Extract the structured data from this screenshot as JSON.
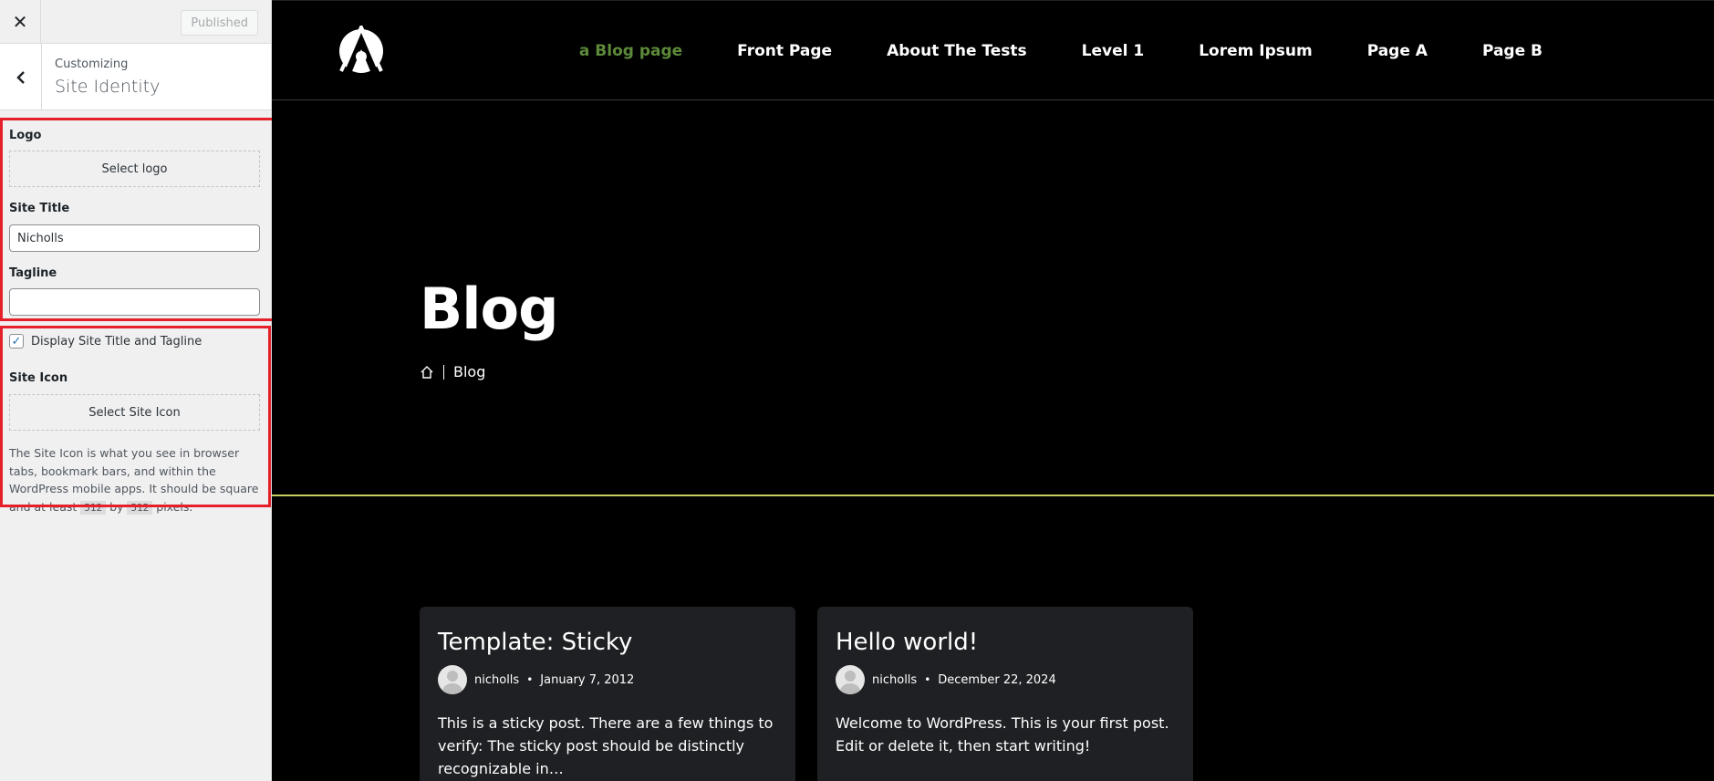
{
  "customizer": {
    "close_icon": "close-icon",
    "publish_label": "Published",
    "back_icon": "chevron-left-icon",
    "crumb": "Customizing",
    "section_title": "Site Identity",
    "logo_label": "Logo",
    "logo_button": "Select logo",
    "site_title_label": "Site Title",
    "site_title_value": "Nicholls",
    "tagline_label": "Tagline",
    "tagline_value": "",
    "display_label": "Display Site Title and Tagline",
    "display_checked": true,
    "site_icon_label": "Site Icon",
    "site_icon_button": "Select Site Icon",
    "site_icon_desc_pre": "The Site Icon is what you see in browser tabs, bookmark bars, and within the WordPress mobile apps. It should be square and at least ",
    "site_icon_code1": "512",
    "site_icon_by": " by ",
    "site_icon_code2": "512",
    "site_icon_desc_post": " pixels."
  },
  "site": {
    "nav": [
      "a Blog page",
      "Front Page",
      "About The Tests",
      "Level 1",
      "Lorem Ipsum",
      "Page A",
      "Page B"
    ],
    "active_nav": 0,
    "hero_title": "Blog",
    "breadcrumb_home_icon": "home-icon",
    "breadcrumb_current": "Blog",
    "accent_color": "#c9d25f",
    "posts": [
      {
        "title": "Template: Sticky",
        "author": "nicholls",
        "date": "January 7, 2012",
        "excerpt": "This is a sticky post. There are a few things to verify: The sticky post should be distinctly recognizable in…"
      },
      {
        "title": "Hello world!",
        "author": "nicholls",
        "date": "December 22, 2024",
        "excerpt": "Welcome to WordPress. This is your first post. Edit or delete it, then start writing!"
      }
    ]
  }
}
